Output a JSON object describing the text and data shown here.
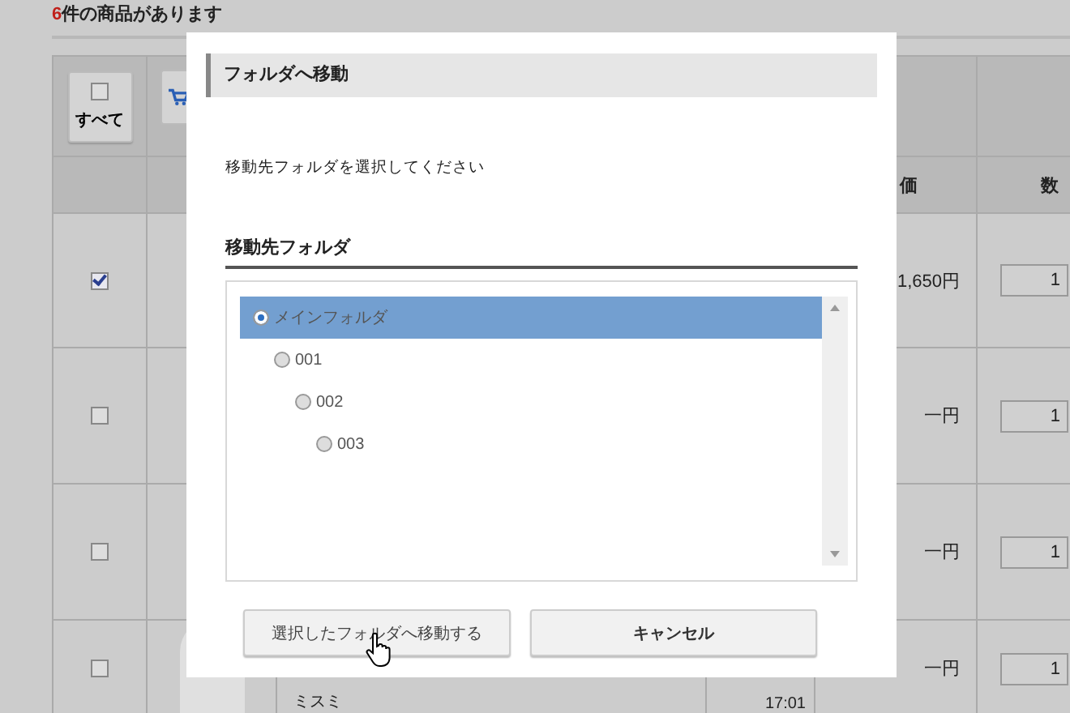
{
  "page": {
    "count": "6",
    "count_text": "件の商品があります"
  },
  "table": {
    "select_all": {
      "label": "すべて",
      "checked": false
    },
    "columns": [
      "価",
      "数"
    ],
    "rows": [
      {
        "checked": true,
        "price": "1,650円",
        "quantity": "1"
      },
      {
        "checked": false,
        "price": "一円",
        "quantity": "1"
      },
      {
        "checked": false,
        "price": "一円",
        "quantity": "1"
      },
      {
        "checked": false,
        "maker": "ミスミ",
        "time": "17:01",
        "price": "一円",
        "quantity": "1"
      }
    ]
  },
  "dialog": {
    "title": "フォルダへ移動",
    "instruction": "移動先フォルダを選択してください",
    "section_title": "移動先フォルダ",
    "folders": [
      {
        "label": "メインフォルダ",
        "selected": true,
        "children": [
          {
            "label": "001",
            "selected": false,
            "children": [
              {
                "label": "002",
                "selected": false,
                "children": [
                  {
                    "label": "003",
                    "selected": false
                  }
                ]
              }
            ]
          }
        ]
      }
    ],
    "buttons": [
      {
        "label": "選択したフォルダへ移動する",
        "kind": "primary"
      },
      {
        "label": "キャンセル",
        "kind": "cancel"
      }
    ]
  }
}
